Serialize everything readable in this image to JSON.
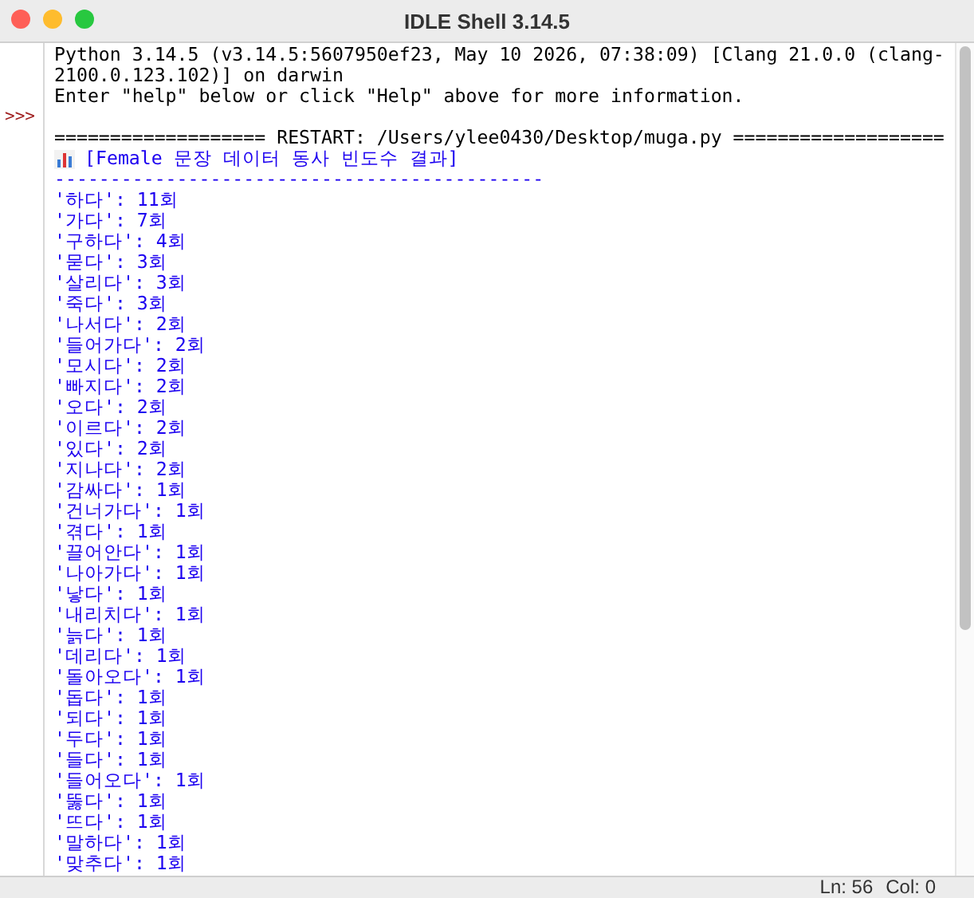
{
  "window": {
    "title": "IDLE Shell 3.14.5"
  },
  "shell": {
    "lines": [
      {
        "kind": "banner",
        "text": "Python 3.14.5 (v3.14.5:5607950ef23, May 10 2026, 07:38:09) [Clang 21.0.0 (clang-"
      },
      {
        "kind": "banner",
        "text": "2100.0.123.102)] on darwin"
      },
      {
        "kind": "banner",
        "text": "Enter \"help\" below or click \"Help\" above for more information."
      },
      {
        "kind": "blank",
        "prompt": ">>>"
      },
      {
        "kind": "banner",
        "text": "=================== RESTART: /Users/ylee0430/Desktop/muga.py ==================="
      },
      {
        "kind": "header",
        "text": "[Female 문장 데이터 동사 빈도수 결과]"
      },
      {
        "kind": "stdout",
        "text": "--------------------------------------------"
      },
      {
        "kind": "stdout",
        "text": "'하다': 11회"
      },
      {
        "kind": "stdout",
        "text": "'가다': 7회"
      },
      {
        "kind": "stdout",
        "text": "'구하다': 4회"
      },
      {
        "kind": "stdout",
        "text": "'묻다': 3회"
      },
      {
        "kind": "stdout",
        "text": "'살리다': 3회"
      },
      {
        "kind": "stdout",
        "text": "'죽다': 3회"
      },
      {
        "kind": "stdout",
        "text": "'나서다': 2회"
      },
      {
        "kind": "stdout",
        "text": "'들어가다': 2회"
      },
      {
        "kind": "stdout",
        "text": "'모시다': 2회"
      },
      {
        "kind": "stdout",
        "text": "'빠지다': 2회"
      },
      {
        "kind": "stdout",
        "text": "'오다': 2회"
      },
      {
        "kind": "stdout",
        "text": "'이르다': 2회"
      },
      {
        "kind": "stdout",
        "text": "'있다': 2회"
      },
      {
        "kind": "stdout",
        "text": "'지나다': 2회"
      },
      {
        "kind": "stdout",
        "text": "'감싸다': 1회"
      },
      {
        "kind": "stdout",
        "text": "'건너가다': 1회"
      },
      {
        "kind": "stdout",
        "text": "'겪다': 1회"
      },
      {
        "kind": "stdout",
        "text": "'끌어안다': 1회"
      },
      {
        "kind": "stdout",
        "text": "'나아가다': 1회"
      },
      {
        "kind": "stdout",
        "text": "'낳다': 1회"
      },
      {
        "kind": "stdout",
        "text": "'내리치다': 1회"
      },
      {
        "kind": "stdout",
        "text": "'늙다': 1회"
      },
      {
        "kind": "stdout",
        "text": "'데리다': 1회"
      },
      {
        "kind": "stdout",
        "text": "'돌아오다': 1회"
      },
      {
        "kind": "stdout",
        "text": "'돕다': 1회"
      },
      {
        "kind": "stdout",
        "text": "'되다': 1회"
      },
      {
        "kind": "stdout",
        "text": "'두다': 1회"
      },
      {
        "kind": "stdout",
        "text": "'들다': 1회"
      },
      {
        "kind": "stdout",
        "text": "'들어오다': 1회"
      },
      {
        "kind": "stdout",
        "text": "'뚫다': 1회"
      },
      {
        "kind": "stdout",
        "text": "'뜨다': 1회"
      },
      {
        "kind": "stdout",
        "text": "'말하다': 1회"
      },
      {
        "kind": "stdout",
        "text": "'맞추다': 1회"
      }
    ]
  },
  "status_bar": {
    "line": "Ln: 56",
    "column": "Col: 0"
  }
}
